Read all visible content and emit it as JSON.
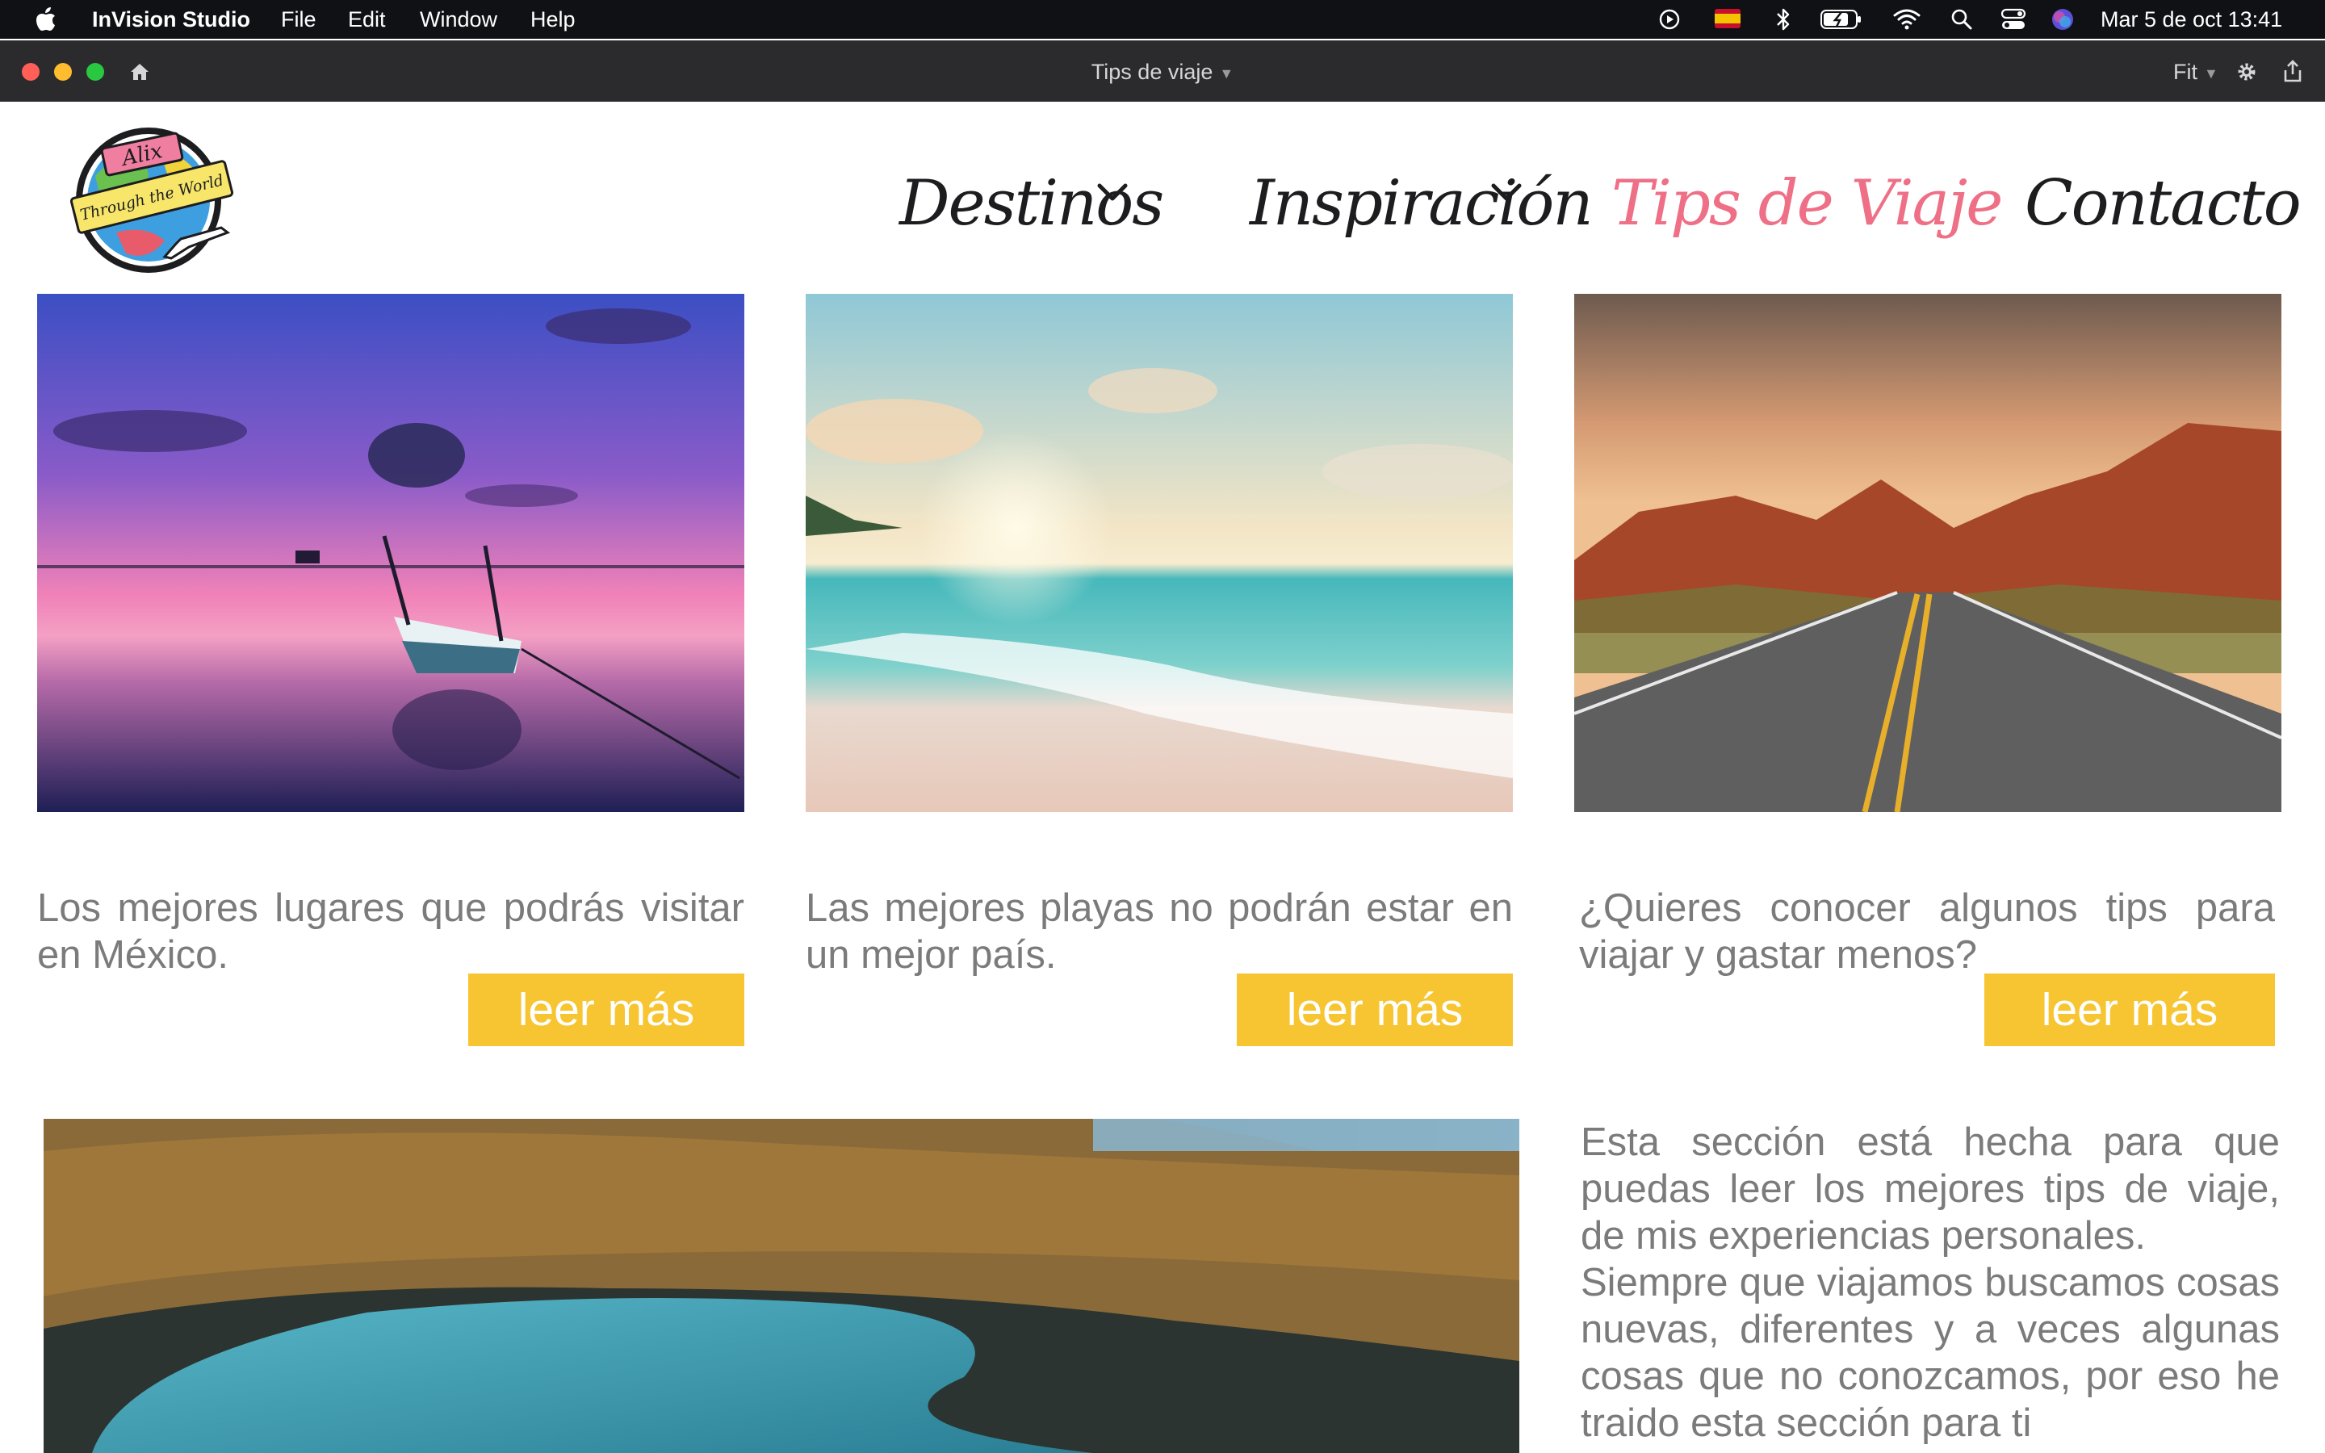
{
  "menubar": {
    "app_name": "InVision Studio",
    "menus": [
      "File",
      "Edit",
      "Window",
      "Help"
    ],
    "clock": "Mar 5 de oct  13:41"
  },
  "window": {
    "title": "Tips de viaje",
    "zoom": "Fit"
  },
  "site": {
    "logo": {
      "line1": "Alix",
      "line2": "Through the World"
    },
    "nav": [
      {
        "label": "Destinos",
        "has_dropdown": true,
        "active": false
      },
      {
        "label": "Inspiración",
        "has_dropdown": true,
        "active": false
      },
      {
        "label": "Tips de Viaje",
        "has_dropdown": false,
        "active": true
      },
      {
        "label": "Contacto",
        "has_dropdown": false,
        "active": false
      }
    ],
    "cards": [
      {
        "image": "sunset-lake-boat-photo",
        "text": "Los mejores lugares que podrás visitar en México.",
        "button": "leer más"
      },
      {
        "image": "beach-sunset-photo",
        "text": "Las mejores playas no podrán estar en un mejor país.",
        "button": "leer más"
      },
      {
        "image": "desert-road-photo",
        "text": "¿Quieres conocer algunos tips para viajar y gastar menos?",
        "button": "leer más"
      }
    ],
    "feature_image": "crater-lake-forest-photo",
    "section_text": [
      "Esta sección está hecha para que puedas leer los mejores tips de viaje, de mis experiencias personales.",
      "Siempre que viajamos buscamos cosas nuevas, diferentes y a veces algunas cosas que no conozcamos, por eso he traido esta sección para ti"
    ]
  },
  "colors": {
    "accent_pink": "#ee6f86",
    "button_yellow": "#f7c531",
    "body_text": "#7b7b7b",
    "nav_text": "#1d1d1f"
  }
}
